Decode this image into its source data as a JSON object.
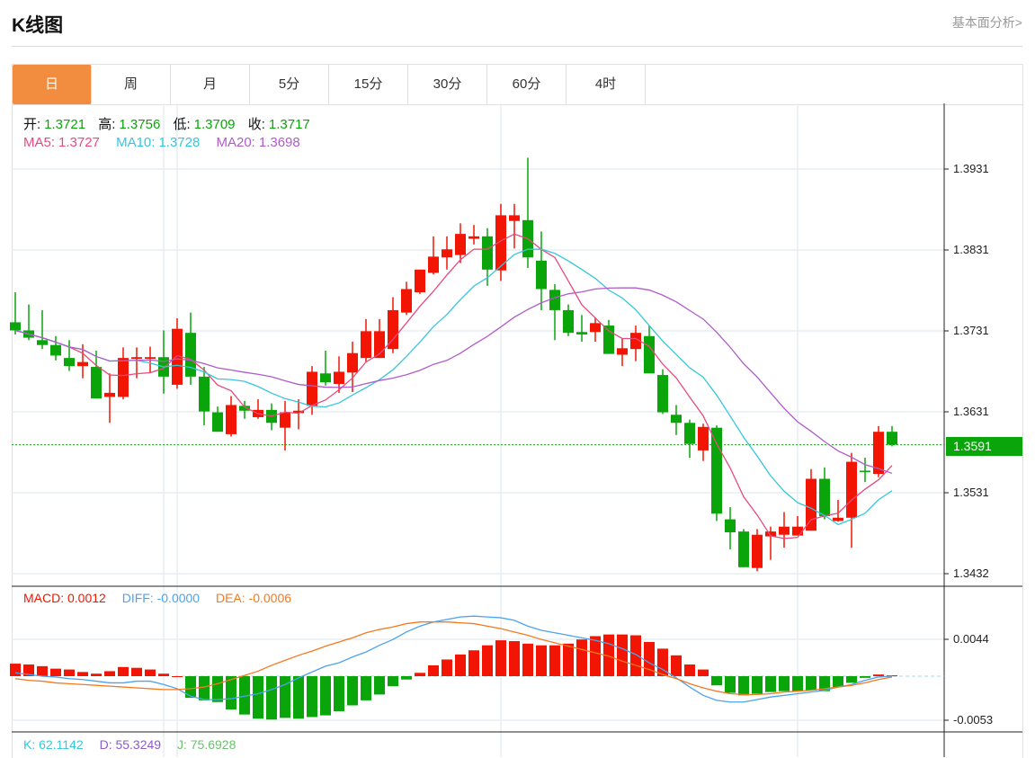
{
  "header": {
    "title": "K线图",
    "link": "基本面分析>"
  },
  "tabs": [
    {
      "label": "日",
      "active": true
    },
    {
      "label": "周"
    },
    {
      "label": "月"
    },
    {
      "label": "5分"
    },
    {
      "label": "15分"
    },
    {
      "label": "30分"
    },
    {
      "label": "60分"
    },
    {
      "label": "4时"
    }
  ],
  "ohlc": {
    "open_label": "开:",
    "open": "1.3721",
    "high_label": "高:",
    "high": "1.3756",
    "low_label": "低:",
    "low": "1.3709",
    "close_label": "收:",
    "close": "1.3717"
  },
  "ma": {
    "ma5_label": "MA5:",
    "ma5": "1.3727",
    "ma10_label": "MA10:",
    "ma10": "1.3728",
    "ma20_label": "MA20:",
    "ma20": "1.3698"
  },
  "macd_legend": {
    "macd": "MACD: 0.0012",
    "diff": "DIFF: -0.0000",
    "dea": "DEA: -0.0006"
  },
  "kdj_legend": {
    "k": "K: 62.1142",
    "d": "D: 55.3249",
    "j": "J: 75.6928"
  },
  "current_price": "1.3591",
  "colors": {
    "up": "#f21503",
    "down": "#0aa50a",
    "ma5": "#e84a7c",
    "ma10": "#36c6dc",
    "ma20": "#b05cc8",
    "diff": "#4ba3f0",
    "dea": "#f5791f",
    "accent": "#f28c3e"
  },
  "chart_data": {
    "type": "candlestick",
    "price_axis": {
      "ticks": [
        "1.3931",
        "1.3831",
        "1.3731",
        "1.3631",
        "1.3531",
        "1.3432"
      ],
      "range": [
        1.3432,
        1.3931
      ]
    },
    "macd_axis": {
      "ticks": [
        "0.0044",
        "-0.0053"
      ],
      "range": [
        -0.0053,
        0.0044
      ]
    },
    "candles": [
      [
        1.3742,
        1.3779,
        1.3727,
        1.3732
      ],
      [
        1.3732,
        1.3764,
        1.372,
        1.3723
      ],
      [
        1.372,
        1.3757,
        1.3709,
        1.3714
      ],
      [
        1.3714,
        1.3725,
        1.3695,
        1.3701
      ],
      [
        1.3698,
        1.372,
        1.3682,
        1.3688
      ],
      [
        1.3688,
        1.3715,
        1.3673,
        1.3693
      ],
      [
        1.3687,
        1.3707,
        1.3648,
        1.3648
      ],
      [
        1.365,
        1.3679,
        1.3618,
        1.3655
      ],
      [
        1.365,
        1.3711,
        1.3647,
        1.3698
      ],
      [
        1.3697,
        1.3711,
        1.3673,
        1.3699
      ],
      [
        1.3697,
        1.3712,
        1.368,
        1.3699
      ],
      [
        1.3699,
        1.3732,
        1.3654,
        1.3675
      ],
      [
        1.3665,
        1.3747,
        1.366,
        1.3734
      ],
      [
        1.3729,
        1.3754,
        1.3665,
        1.3675
      ],
      [
        1.3675,
        1.3687,
        1.3615,
        1.3632
      ],
      [
        1.3631,
        1.3638,
        1.3607,
        1.3607
      ],
      [
        1.3604,
        1.3651,
        1.3601,
        1.364
      ],
      [
        1.3639,
        1.3645,
        1.3623,
        1.3633
      ],
      [
        1.3625,
        1.3647,
        1.3623,
        1.3634
      ],
      [
        1.3634,
        1.3642,
        1.3609,
        1.3618
      ],
      [
        1.3612,
        1.3645,
        1.3584,
        1.3631
      ],
      [
        1.363,
        1.3647,
        1.361,
        1.3633
      ],
      [
        1.3639,
        1.3688,
        1.3628,
        1.3681
      ],
      [
        1.3679,
        1.3707,
        1.3664,
        1.3668
      ],
      [
        1.3666,
        1.37,
        1.3655,
        1.3681
      ],
      [
        1.368,
        1.3718,
        1.3656,
        1.3704
      ],
      [
        1.3698,
        1.3746,
        1.3693,
        1.3731
      ],
      [
        1.3698,
        1.3746,
        1.3698,
        1.3731
      ],
      [
        1.3709,
        1.3773,
        1.3704,
        1.3757
      ],
      [
        1.3754,
        1.3792,
        1.3751,
        1.3783
      ],
      [
        1.3779,
        1.3807,
        1.3777,
        1.3807
      ],
      [
        1.3803,
        1.3848,
        1.3801,
        1.3823
      ],
      [
        1.3822,
        1.3848,
        1.3807,
        1.3832
      ],
      [
        1.3825,
        1.3864,
        1.3815,
        1.3851
      ],
      [
        1.3845,
        1.3862,
        1.3838,
        1.3848
      ],
      [
        1.3848,
        1.3858,
        1.3787,
        1.3807
      ],
      [
        1.3806,
        1.3888,
        1.3793,
        1.3874
      ],
      [
        1.3867,
        1.3888,
        1.3833,
        1.3874
      ],
      [
        1.3868,
        1.3945,
        1.3809,
        1.3822
      ],
      [
        1.3818,
        1.3854,
        1.3757,
        1.3783
      ],
      [
        1.3782,
        1.3789,
        1.372,
        1.3757
      ],
      [
        1.3757,
        1.3764,
        1.3725,
        1.3729
      ],
      [
        1.373,
        1.3751,
        1.3718,
        1.3727
      ],
      [
        1.373,
        1.3748,
        1.3718,
        1.3741
      ],
      [
        1.3738,
        1.3745,
        1.3703,
        1.3703
      ],
      [
        1.3702,
        1.3722,
        1.3688,
        1.371
      ],
      [
        1.3709,
        1.3738,
        1.3694,
        1.3729
      ],
      [
        1.3725,
        1.3738,
        1.3679,
        1.3679
      ],
      [
        1.3677,
        1.3684,
        1.3629,
        1.3631
      ],
      [
        1.3628,
        1.364,
        1.3603,
        1.3618
      ],
      [
        1.3618,
        1.3622,
        1.3575,
        1.3592
      ],
      [
        1.3584,
        1.3617,
        1.3571,
        1.3613
      ],
      [
        1.3612,
        1.3615,
        1.3497,
        1.3506
      ],
      [
        1.3499,
        1.3514,
        1.3462,
        1.3483
      ],
      [
        1.3484,
        1.3487,
        1.344,
        1.344
      ],
      [
        1.3439,
        1.3487,
        1.3435,
        1.348
      ],
      [
        1.3478,
        1.349,
        1.3449,
        1.3484
      ],
      [
        1.348,
        1.3508,
        1.3464,
        1.349
      ],
      [
        1.3479,
        1.3503,
        1.3482,
        1.349
      ],
      [
        1.3485,
        1.3561,
        1.3485,
        1.3549
      ],
      [
        1.3549,
        1.3563,
        1.3499,
        1.3503
      ],
      [
        1.3497,
        1.3523,
        1.3496,
        1.3501
      ],
      [
        1.3501,
        1.3581,
        1.3464,
        1.357
      ],
      [
        1.3559,
        1.3575,
        1.3545,
        1.3558
      ],
      [
        1.3555,
        1.3614,
        1.3551,
        1.3607
      ],
      [
        1.3607,
        1.3614,
        1.3589,
        1.3591
      ]
    ],
    "macd_hist": [
      0.0015,
      0.0014,
      0.0012,
      0.0009,
      0.0008,
      0.0005,
      0.0003,
      0.0006,
      0.0011,
      0.001,
      0.0008,
      0.0003,
      0.0,
      -0.0026,
      -0.0029,
      -0.0031,
      -0.004,
      -0.0046,
      -0.0051,
      -0.0052,
      -0.005,
      -0.0051,
      -0.0049,
      -0.0047,
      -0.0042,
      -0.0035,
      -0.0029,
      -0.0022,
      -0.0012,
      -0.0004,
      0.0004,
      0.0013,
      0.002,
      0.0026,
      0.0031,
      0.0037,
      0.0043,
      0.0042,
      0.0039,
      0.0037,
      0.0037,
      0.0039,
      0.0044,
      0.0048,
      0.005,
      0.005,
      0.0049,
      0.0041,
      0.0033,
      0.0025,
      0.0014,
      0.0008,
      -0.0011,
      -0.002,
      -0.0023,
      -0.0021,
      -0.0019,
      -0.0018,
      -0.0018,
      -0.0017,
      -0.0018,
      -0.0013,
      -0.0008,
      -0.0002,
      0.0002,
      0.0001
    ],
    "diff": [
      0.0004,
      0.0002,
      0.0,
      -0.0001,
      -0.0003,
      -0.0004,
      -0.0006,
      -0.0008,
      -0.0008,
      -0.0006,
      -0.0006,
      -0.001,
      -0.0015,
      -0.0024,
      -0.0028,
      -0.0028,
      -0.0027,
      -0.0024,
      -0.0021,
      -0.0016,
      -0.001,
      -0.0002,
      0.0005,
      0.0012,
      0.0016,
      0.0023,
      0.0029,
      0.0037,
      0.0044,
      0.0053,
      0.006,
      0.0065,
      0.0068,
      0.0071,
      0.0072,
      0.0071,
      0.007,
      0.0067,
      0.006,
      0.0055,
      0.0052,
      0.0049,
      0.0046,
      0.0043,
      0.0039,
      0.0033,
      0.0026,
      0.0016,
      0.0008,
      -0.0002,
      -0.0013,
      -0.0023,
      -0.0029,
      -0.0031,
      -0.0031,
      -0.0028,
      -0.0025,
      -0.0023,
      -0.0021,
      -0.0019,
      -0.0017,
      -0.0013,
      -0.001,
      -0.0005,
      -0.0001,
      -0.0
    ],
    "dea": [
      -0.0003,
      -0.0005,
      -0.0006,
      -0.0008,
      -0.0009,
      -0.001,
      -0.0011,
      -0.0012,
      -0.0013,
      -0.0014,
      -0.0015,
      -0.0016,
      -0.0016,
      -0.0015,
      -0.0013,
      -0.0009,
      -0.0004,
      0.0001,
      0.0006,
      0.0013,
      0.0019,
      0.0025,
      0.003,
      0.0036,
      0.0041,
      0.0046,
      0.0052,
      0.0056,
      0.0059,
      0.0063,
      0.0065,
      0.0065,
      0.0065,
      0.0064,
      0.0063,
      0.006,
      0.0057,
      0.0053,
      0.0049,
      0.0044,
      0.004,
      0.0036,
      0.0032,
      0.0028,
      0.0024,
      0.0018,
      0.0013,
      0.0008,
      0.0002,
      -0.0003,
      -0.0009,
      -0.0014,
      -0.0018,
      -0.0021,
      -0.0022,
      -0.0022,
      -0.0021,
      -0.0019,
      -0.0018,
      -0.0017,
      -0.0015,
      -0.0013,
      -0.0011,
      -0.0008,
      -0.0004,
      -0.0001
    ]
  }
}
